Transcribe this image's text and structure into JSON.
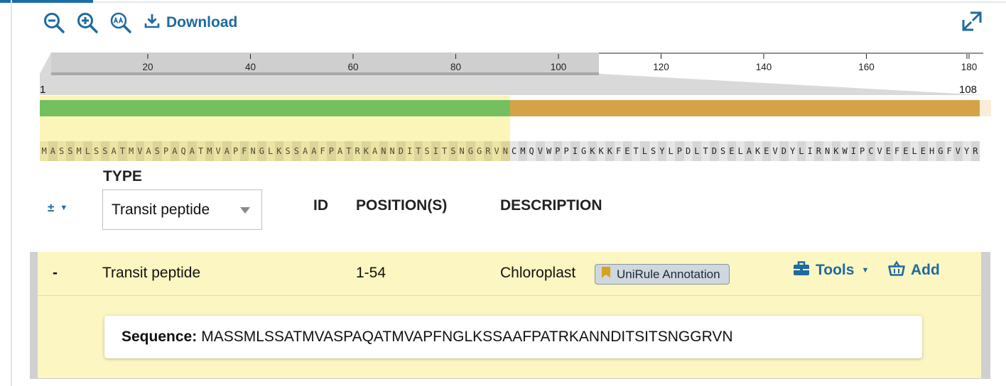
{
  "toolbar": {
    "zoom_out_icon": "zoom-out-icon",
    "zoom_in_icon": "zoom-in-icon",
    "zoom_reset_icon": "zoom-reset-icon",
    "download_label": "Download",
    "fullscreen_icon": "fullscreen-icon"
  },
  "viewer": {
    "axis_ticks": [
      "20",
      "40",
      "60",
      "80",
      "100",
      "120",
      "140",
      "160",
      "180"
    ],
    "range_start": "1",
    "range_end": "108",
    "sequence": "MASSMLSSATMVASPAQATMVAPFNGLKSSAAFPATRKANNDITSITSNGGRVNCMQVWPPIGKKKFETLSYLPDLTDSELAKEVDYLIRNKWIPCVEFELEHGFVYR",
    "highlight_length": 54,
    "colors": {
      "transit": "#74c05e",
      "chain": "#d4a347",
      "highlight": "#fbf4b2"
    }
  },
  "table": {
    "plusminus_label": "±",
    "type_heading": "TYPE",
    "type_filter_value": "Transit peptide",
    "headers": {
      "id": "ID",
      "positions": "POSITION(S)",
      "description": "DESCRIPTION"
    },
    "row": {
      "toggle": "-",
      "type": "Transit peptide",
      "id": "",
      "positions": "1-54",
      "description": "Chloroplast",
      "badge": "UniRule Annotation",
      "tools_label": "Tools",
      "add_label": "Add"
    },
    "detail": {
      "sequence_label": "Sequence:",
      "sequence_value": "MASSMLSSATMVASPAQATMVAPFNGLKSSAAFPATRKANNDITSITSNGGRVN"
    }
  }
}
